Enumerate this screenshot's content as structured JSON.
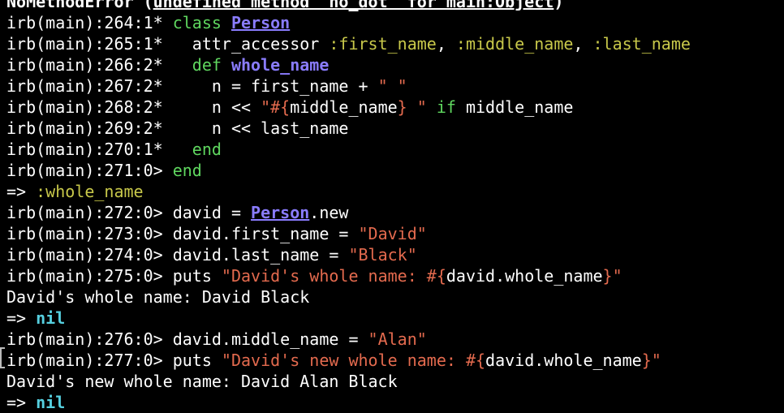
{
  "terminal": {
    "colors": {
      "background": "#000000",
      "text": "#ffffff",
      "keyword": "#5fd75f",
      "constant": "#8a7cff",
      "symbol": "#c8c84a",
      "string": "#e36a4e",
      "nil": "#56d0e0"
    },
    "error_line": {
      "prefix": "NoMethodError (",
      "underlined": "undefined method `no_dot' for main:Object",
      "suffix": ")"
    },
    "lines": [
      {
        "prompt": "irb(main):264:1* ",
        "kw": "class",
        "sp": " ",
        "const": "Person"
      },
      {
        "prompt": "irb(main):265:1* ",
        "indent": "  ",
        "code": "attr_accessor ",
        "s1": ":first_name",
        "c1": ", ",
        "s2": ":middle_name",
        "c2": ", ",
        "s3": ":last_name"
      },
      {
        "prompt": "irb(main):266:2* ",
        "indent": "  ",
        "kw": "def",
        "sp": " ",
        "meth": "whole_name"
      },
      {
        "prompt": "irb(main):267:2* ",
        "indent": "    ",
        "code": "n = first_name + ",
        "str": "\" \""
      },
      {
        "prompt": "irb(main):268:2* ",
        "indent": "    ",
        "code": "n << ",
        "str1": "\"#{",
        "mid": "middle_name",
        "str2": "} \"",
        "sp": " ",
        "kw": "if",
        "tail": " middle_name"
      },
      {
        "prompt": "irb(main):269:2* ",
        "indent": "    ",
        "code": "n << last_name"
      },
      {
        "prompt": "irb(main):270:1* ",
        "indent": "  ",
        "kw": "end"
      },
      {
        "prompt": "irb(main):271:0> ",
        "kw": "end"
      },
      {
        "arrow": "=> ",
        "sym": ":whole_name"
      },
      {
        "prompt": "irb(main):272:0> ",
        "code": "david = ",
        "const": "Person",
        "tail": ".new"
      },
      {
        "prompt": "irb(main):273:0> ",
        "code": "david.first_name = ",
        "str": "\"David\""
      },
      {
        "prompt": "irb(main):274:0> ",
        "code": "david.last_name = ",
        "str": "\"Black\""
      },
      {
        "prompt": "irb(main):275:0> ",
        "code": "puts ",
        "str1": "\"David's whole name: #{",
        "mid": "david.whole_name",
        "str2": "}\""
      },
      {
        "output": "David's whole name: David Black"
      },
      {
        "arrow": "=> ",
        "nil": "nil"
      },
      {
        "prompt": "irb(main):276:0> ",
        "code": "david.middle_name = ",
        "str": "\"Alan\""
      },
      {
        "prompt": "irb(main):277:0> ",
        "code": "puts ",
        "str1": "\"David's new whole name: #{",
        "mid": "david.whole_name",
        "str2": "}\""
      },
      {
        "output": "David's new whole name: David Alan Black"
      },
      {
        "arrow": "=> ",
        "nil": "nil"
      }
    ]
  }
}
